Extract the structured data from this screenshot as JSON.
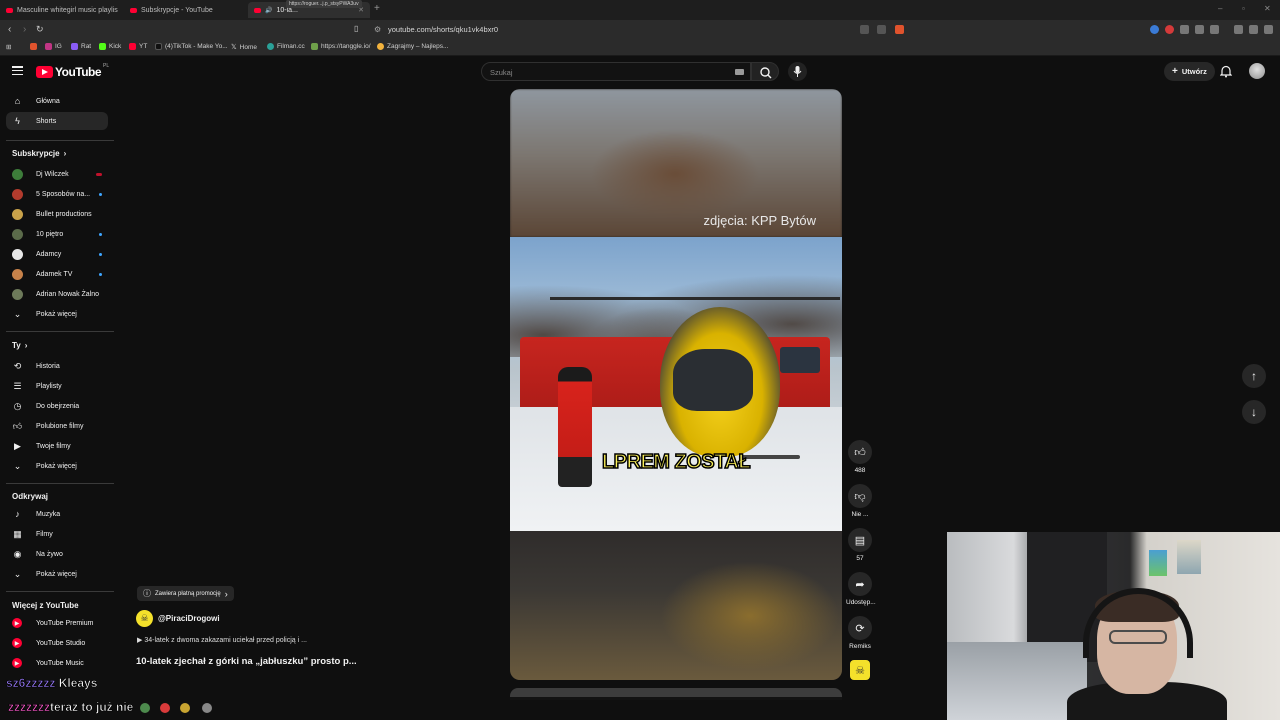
{
  "browser": {
    "tabs": [
      {
        "label": "Masculine whitegirl music playlis",
        "active": false
      },
      {
        "label": "Subskrypcje - YouTube",
        "active": false
      },
      {
        "label": "10-la...",
        "active": true
      }
    ],
    "tab_tooltip": "https://roguer...j.p_stsyPWA3uv",
    "url": "youtube.com/shorts/qku1vk4bxr0",
    "bookmarks": [
      "IG",
      "Rat",
      "Kick",
      "YT",
      "(4)TikTok - Make Yo...",
      "Home",
      "Filman.cc",
      "https://tanggle.io/",
      "Zagrajmy – Najleps..."
    ]
  },
  "header": {
    "logo_text": "YouTube",
    "logo_country": "PL",
    "search_placeholder": "Szukaj",
    "create_label": "Utwórz"
  },
  "sidebar": {
    "main": [
      {
        "label": "Główna",
        "icon": "home-icon"
      },
      {
        "label": "Shorts",
        "icon": "shorts-icon",
        "active": true
      }
    ],
    "subscriptions_title": "Subskrypcje",
    "subscriptions": [
      {
        "label": "Dj Wilczek",
        "indicator": "live",
        "color": "#3d7d3a"
      },
      {
        "label": "5 Sposobów na...",
        "indicator": "new",
        "color": "#b23b2d"
      },
      {
        "label": "Bullet productions",
        "indicator": "",
        "color": "#c9a24a"
      },
      {
        "label": "10 piętro",
        "indicator": "new",
        "color": "#5b6b4a"
      },
      {
        "label": "Adamcy",
        "indicator": "new",
        "color": "#e8e8e8"
      },
      {
        "label": "Adamek TV",
        "indicator": "new",
        "color": "#c7824a"
      },
      {
        "label": "Adrian Nowak Żalno",
        "indicator": "",
        "color": "#6d7a5a"
      }
    ],
    "subscriptions_more": "Pokaż więcej",
    "you_title": "Ty",
    "you": [
      {
        "label": "Historia",
        "icon": "history-icon"
      },
      {
        "label": "Playlisty",
        "icon": "playlist-icon"
      },
      {
        "label": "Do obejrzenia",
        "icon": "watch-later-icon"
      },
      {
        "label": "Polubione filmy",
        "icon": "like-icon"
      },
      {
        "label": "Twoje filmy",
        "icon": "your-videos-icon"
      }
    ],
    "you_more": "Pokaż więcej",
    "explore_title": "Odkrywaj",
    "explore": [
      {
        "label": "Muzyka",
        "icon": "music-icon"
      },
      {
        "label": "Filmy",
        "icon": "movies-icon"
      },
      {
        "label": "Na żywo",
        "icon": "live-icon"
      }
    ],
    "explore_more": "Pokaż więcej",
    "more_title": "Więcej z YouTube",
    "more": [
      {
        "label": "YouTube Premium"
      },
      {
        "label": "YouTube Studio"
      },
      {
        "label": "YouTube Music"
      }
    ]
  },
  "short": {
    "credit": "zdjęcia: KPP Bytów",
    "caption": "LPREM ZOSTAŁ",
    "promo_label": "Zawiera płatną promocję",
    "channel": "@PiraciDrogowi",
    "related": "34-latek z dwoma zakazami uciekał przed policją i ...",
    "title": "10-latek zjechał z górki na „jabłuszku” prosto p..."
  },
  "actions": {
    "likes": "488",
    "dislike_label": "Nie ...",
    "comments": "57",
    "share_label": "Udostęp...",
    "remix_label": "Remiks"
  },
  "overlay": {
    "kleays_prefix": "sz6zzzzz",
    "kleays_name": "Kleays",
    "ticker_prefix": "zzzzzzz",
    "ticker_text": "teraz to już nie"
  }
}
